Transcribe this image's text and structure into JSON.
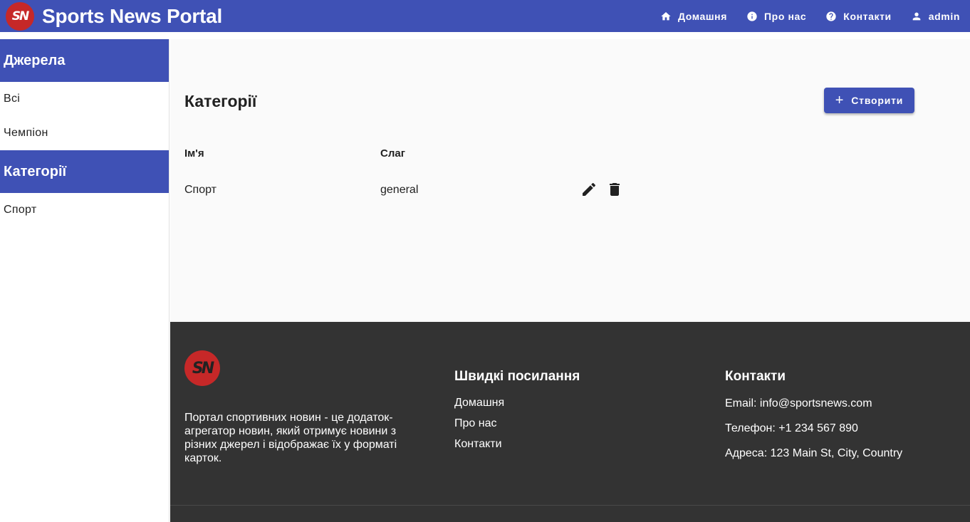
{
  "header": {
    "logo_text": "SN",
    "title": "Sports News Portal",
    "nav": [
      {
        "label": "Домашня",
        "icon": "home-icon"
      },
      {
        "label": "Про нас",
        "icon": "info-icon"
      },
      {
        "label": "Контакти",
        "icon": "help-icon"
      },
      {
        "label": "admin",
        "icon": "person-icon"
      }
    ]
  },
  "sidebar": {
    "sources_title": "Джерела",
    "sources": [
      "Всі",
      "Чемпіон"
    ],
    "categories_title": "Категорії",
    "categories": [
      "Спорт"
    ]
  },
  "main": {
    "title": "Категорії",
    "create_label": "Створити",
    "columns": {
      "name": "Ім'я",
      "slug": "Слаг"
    },
    "rows": [
      {
        "name": "Спорт",
        "slug": "general"
      }
    ]
  },
  "footer": {
    "logo_text": "SN",
    "description": "Портал спортивних новин - це додаток-агрегатор новин, який отримує новини з різних джерел і відображає їх у форматі карток.",
    "links_title": "Швидкі посилання",
    "links": [
      "Домашня",
      "Про нас",
      "Контакти"
    ],
    "contacts_title": "Контакти",
    "contacts": [
      "Email: info@sportsnews.com",
      "Телефон: +1 234 567 890",
      "Адреса: 123 Main St, City, Country"
    ]
  },
  "colors": {
    "primary": "#3f51b5",
    "logo_red": "#c62828",
    "footer_bg": "#333333",
    "main_bg": "#fafafa"
  }
}
